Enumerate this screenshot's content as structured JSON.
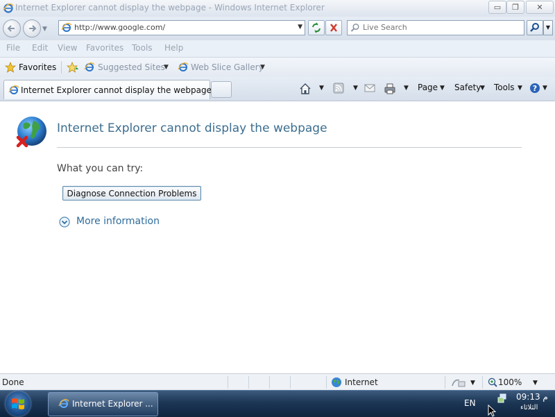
{
  "window": {
    "title": "Internet Explorer cannot display the webpage - Windows Internet Explorer",
    "controls": {
      "minimize": "▭",
      "maximize": "❐",
      "close": "✕"
    }
  },
  "navigation": {
    "address_value": "http://www.google.com/",
    "search_placeholder": "Live Search",
    "icons": [
      "back-icon",
      "forward-icon",
      "refresh-icon",
      "stop-icon",
      "search-icon"
    ]
  },
  "menu": {
    "items": [
      "File",
      "Edit",
      "View",
      "Favorites",
      "Tools",
      "Help"
    ]
  },
  "favorites_bar": {
    "favorites_label": "Favorites",
    "suggested_sites_label": "Suggested Sites",
    "web_slice_label": "Web Slice Gallery"
  },
  "tabs": {
    "active_tab_label": "Internet Explorer cannot display the webpage"
  },
  "command_bar": {
    "page_label": "Page",
    "safety_label": "Safety",
    "tools_label": "Tools",
    "icons": [
      "home-icon",
      "feeds-icon",
      "mail-icon",
      "print-icon",
      "help-icon"
    ]
  },
  "content": {
    "error_title": "Internet Explorer cannot display the webpage",
    "try_label": "What you can try:",
    "diagnose_button": "Diagnose Connection Problems",
    "more_info_label": "More information"
  },
  "status_bar": {
    "status_text": "Done",
    "zone_label": "Internet",
    "zoom_label": "100%"
  },
  "taskbar": {
    "task_label": "Internet Explorer ...",
    "language": "EN",
    "clock_time": "09:13 م",
    "clock_date": "الثلاثاء"
  },
  "colors": {
    "title_link_blue": "#3b6d8f",
    "more_info_blue": "#2f6c9c",
    "taskbar_dark": "#1c3655"
  }
}
